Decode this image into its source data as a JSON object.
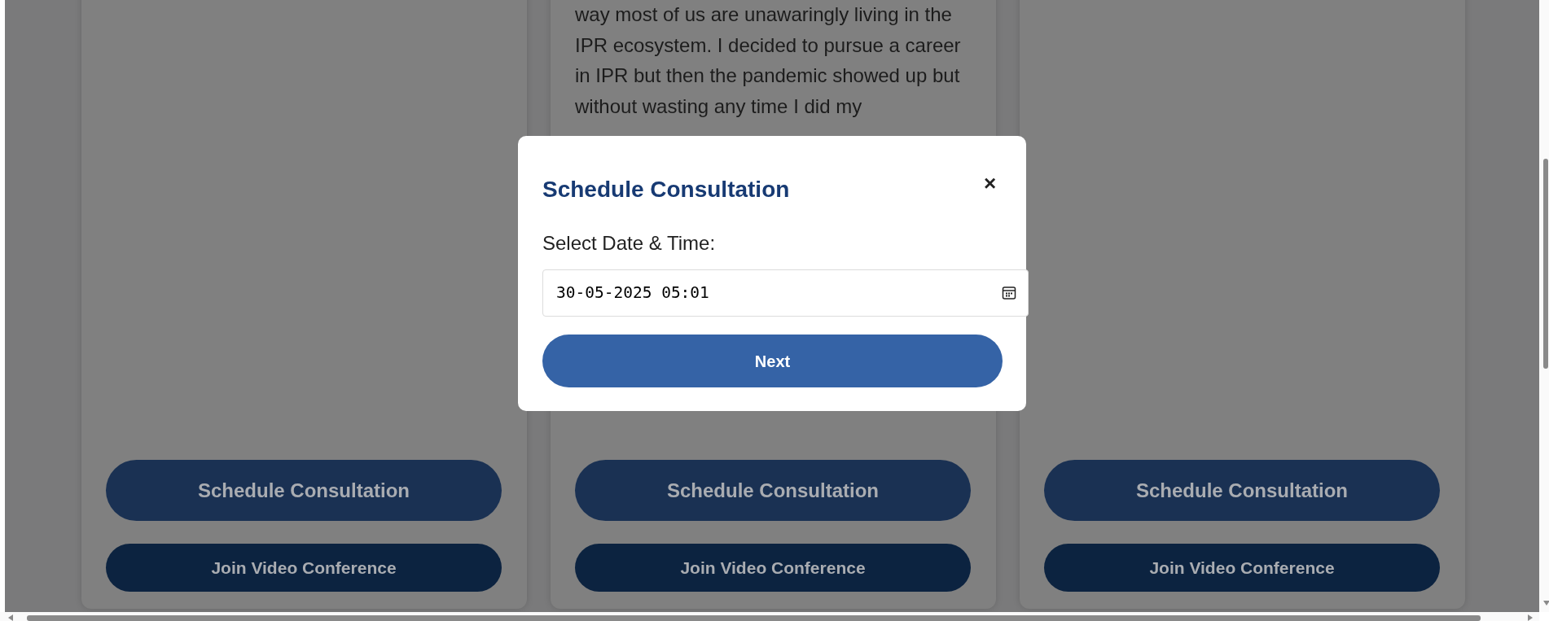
{
  "cards": [
    {
      "buttons": [
        {
          "kind": "schedule",
          "label": "Schedule Consultation"
        },
        {
          "kind": "video",
          "label": "Join Video Conference"
        }
      ]
    },
    {
      "text": "way most of us are unawaringly living in the IPR ecosystem. I decided to pursue a career in IPR but then the pandemic showed up but without wasting any time I did my",
      "buttons": [
        {
          "kind": "schedule",
          "label": "Schedule Consultation"
        },
        {
          "kind": "video",
          "label": "Join Video Conference"
        }
      ]
    },
    {
      "buttons": [
        {
          "kind": "schedule",
          "label": "Schedule Consultation"
        },
        {
          "kind": "video",
          "label": "Join Video Conference"
        }
      ]
    }
  ],
  "modal": {
    "title": "Schedule Consultation",
    "close": "×",
    "label": "Select Date & Time:",
    "value": "30-05-2025 05:01",
    "button": "Next"
  }
}
